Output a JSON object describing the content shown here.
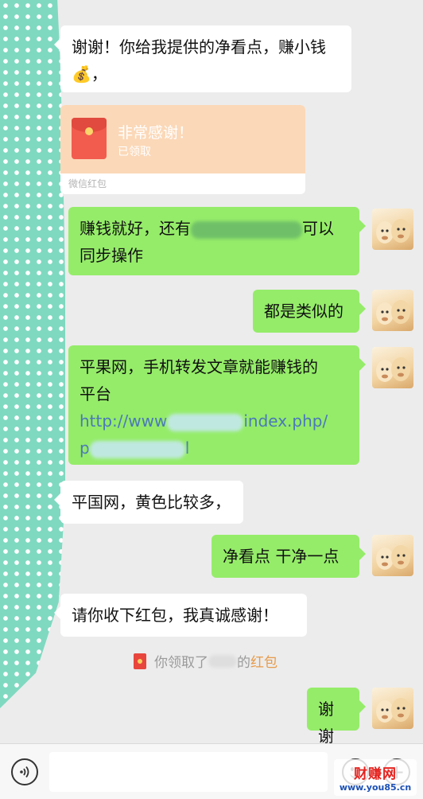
{
  "messages": {
    "m1": {
      "line1": "谢谢！你给我提供的净看点，赚小钱",
      "emoji": "💰",
      "tail": "，"
    },
    "redpacket": {
      "title": "非常感谢！",
      "status": "已领取",
      "footer": "微信红包"
    },
    "m2": {
      "line1_a": "赚钱就好，还有",
      "line1_b": "可以",
      "line2": "同步操作"
    },
    "m3": {
      "text": "都是类似的"
    },
    "m4": {
      "line1": "平果网，手机转发文章就能赚钱的",
      "line2": "平台",
      "link_a": "http://www",
      "link_b": "index.php/",
      "link_c": "p",
      "link_d": "l"
    },
    "m5": {
      "text": "平国网，黄色比较多，"
    },
    "m6": {
      "text": "净看点 干净一点"
    },
    "m7": {
      "text": "请你收下红包，我真诚感谢！"
    },
    "notice": {
      "prefix": "你领取了",
      "suffix": "的",
      "hongbao": "红包"
    },
    "m8": {
      "text": "谢谢"
    }
  },
  "input_bar": {
    "voice_icon": "voice-icon",
    "placeholder": "",
    "emoji_icon": "emoji-icon",
    "plus_label": "+"
  },
  "watermark": {
    "brand": "财赚网",
    "url": "www.you85.cn"
  },
  "colors": {
    "outgoing_bubble": "#95ec69",
    "incoming_bubble": "#ffffff",
    "chat_background": "#ececec",
    "link": "#4a79b8",
    "redpacket": "#fbd8b8"
  }
}
